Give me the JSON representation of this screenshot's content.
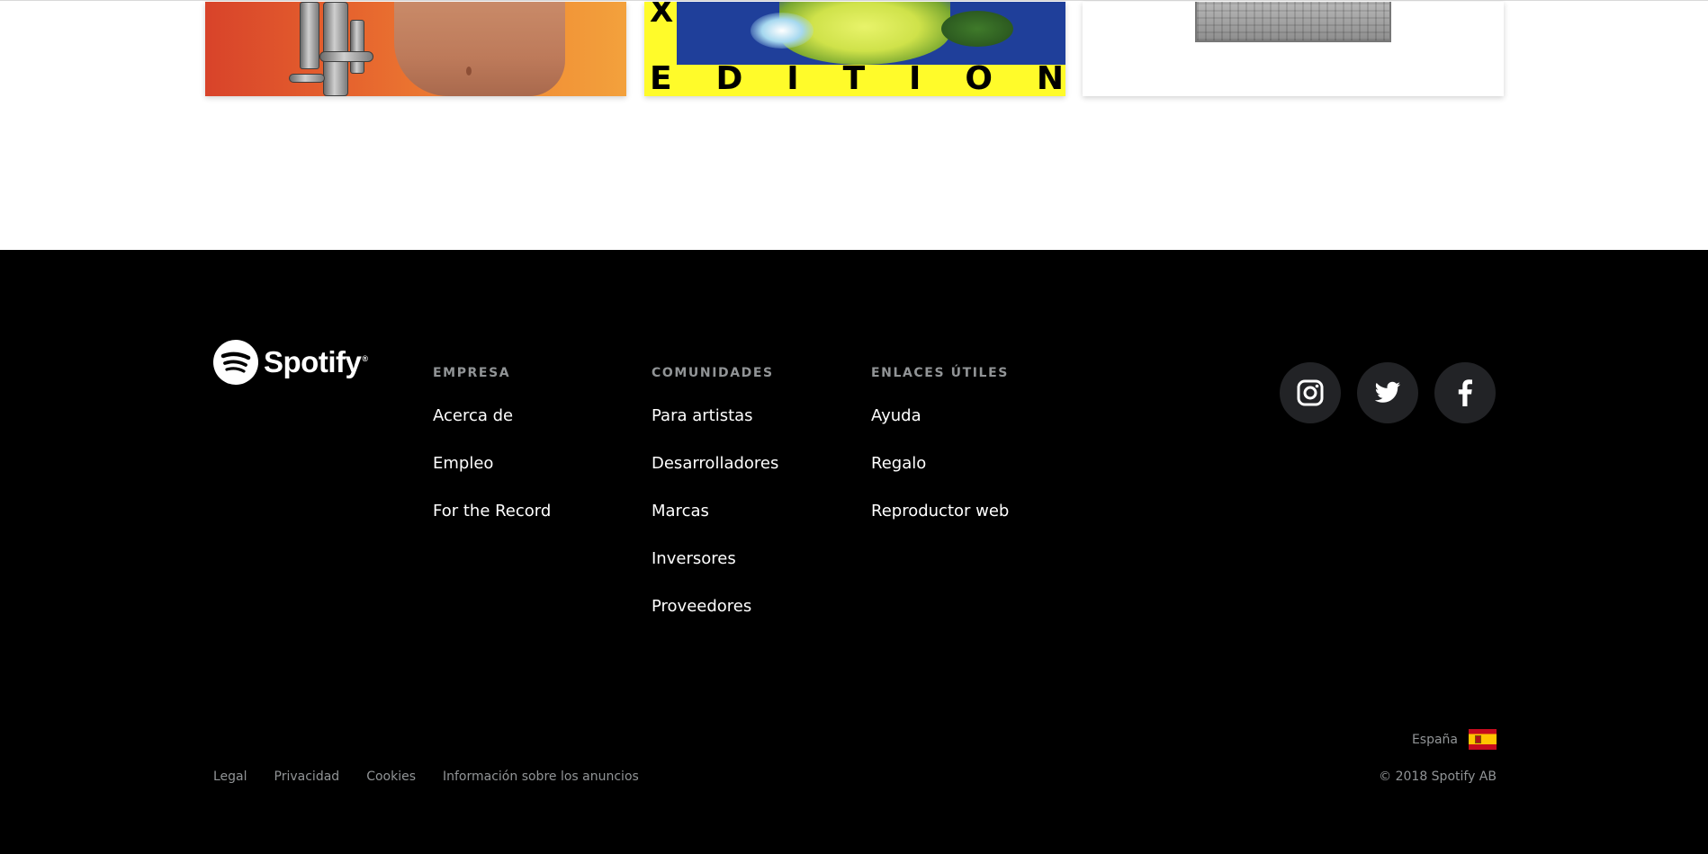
{
  "brand": {
    "name": "Spotify",
    "registered": "®",
    "color": "#ffffff"
  },
  "cards": [
    {
      "name": "album-cover-1"
    },
    {
      "name": "album-cover-2",
      "letter": "X",
      "word": [
        "E",
        "D",
        "I",
        "T",
        "I",
        "O",
        "N"
      ]
    },
    {
      "name": "album-cover-3"
    }
  ],
  "footer": {
    "columns": [
      {
        "title": "EMPRESA",
        "links": [
          "Acerca de",
          "Empleo",
          "For the Record"
        ]
      },
      {
        "title": "COMUNIDADES",
        "links": [
          "Para artistas",
          "Desarrolladores",
          "Marcas",
          "Inversores",
          "Proveedores"
        ]
      },
      {
        "title": "ENLACES ÚTILES",
        "links": [
          "Ayuda",
          "Regalo",
          "Reproductor web"
        ]
      }
    ],
    "social": [
      {
        "name": "instagram-icon"
      },
      {
        "name": "twitter-icon"
      },
      {
        "name": "facebook-icon"
      }
    ],
    "legal_links": [
      "Legal",
      "Privacidad",
      "Cookies",
      "Información sobre los anuncios"
    ],
    "country": "España",
    "copyright": "© 2018 Spotify AB"
  },
  "colors": {
    "footer_bg": "#000000",
    "muted_text": "#919496",
    "social_bg": "#222326"
  }
}
